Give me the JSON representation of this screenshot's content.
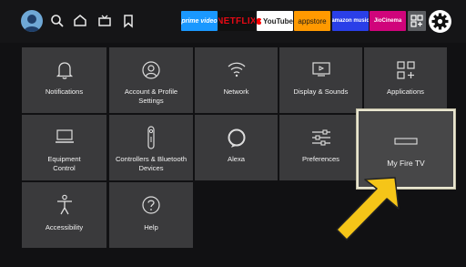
{
  "header": {
    "apps": [
      "prime video",
      "NETFLIX",
      "YouTube",
      "appstore",
      "amazon music",
      "JioCinema"
    ]
  },
  "tiles": {
    "notifications": "Notifications",
    "account_line1": "Account & Profile",
    "account_line2": "Settings",
    "network": "Network",
    "display_sounds": "Display & Sounds",
    "applications": "Applications",
    "equipment_line1": "Equipment",
    "equipment_line2": "Control",
    "controllers_line1": "Controllers & Bluetooth",
    "controllers_line2": "Devices",
    "alexa": "Alexa",
    "preferences": "Preferences",
    "my_fire_tv": "My Fire TV",
    "accessibility": "Accessibility",
    "help": "Help"
  },
  "colors": {
    "tile_bg": "#3a3a3c",
    "focus_border": "#e9e6d0",
    "arrow": "#f5c518",
    "background": "#111113"
  },
  "icons": [
    "profile-avatar-icon",
    "search-icon",
    "home-icon",
    "live-tv-icon",
    "bookmark-icon",
    "app-grid-icon",
    "gear-icon",
    "bell-icon",
    "person-circle-icon",
    "wifi-icon",
    "display-icon",
    "applications-icon",
    "monitor-icon",
    "remote-icon",
    "alexa-icon",
    "sliders-icon",
    "fire-tv-stick-icon",
    "accessibility-icon",
    "help-icon"
  ]
}
